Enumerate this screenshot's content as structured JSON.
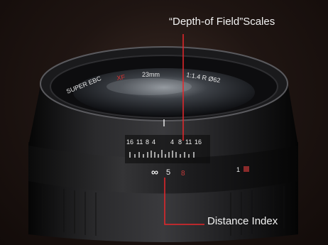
{
  "labels": {
    "depth_of_field": "“Depth-of Field”Scales",
    "distance_index": "Distance Index"
  },
  "lens_barrel": {
    "brand_text": "SUPER EBC",
    "xf_text": "XF",
    "focal_text": "23mm",
    "aperture_text": "1:1.4 R Ø62"
  },
  "dof_scale": {
    "left_numbers": [
      "16",
      "11",
      "8",
      "4"
    ],
    "right_numbers": [
      "4",
      "8",
      "11",
      "16"
    ]
  },
  "distance_scale": {
    "infinity": "∞",
    "mid": "5",
    "right": "8",
    "far_left": "1"
  },
  "colors": {
    "annotation_line": "#e8262b",
    "background": "#1a120f",
    "text": "#f2f2f2",
    "accent_red": "#c43a3a"
  }
}
